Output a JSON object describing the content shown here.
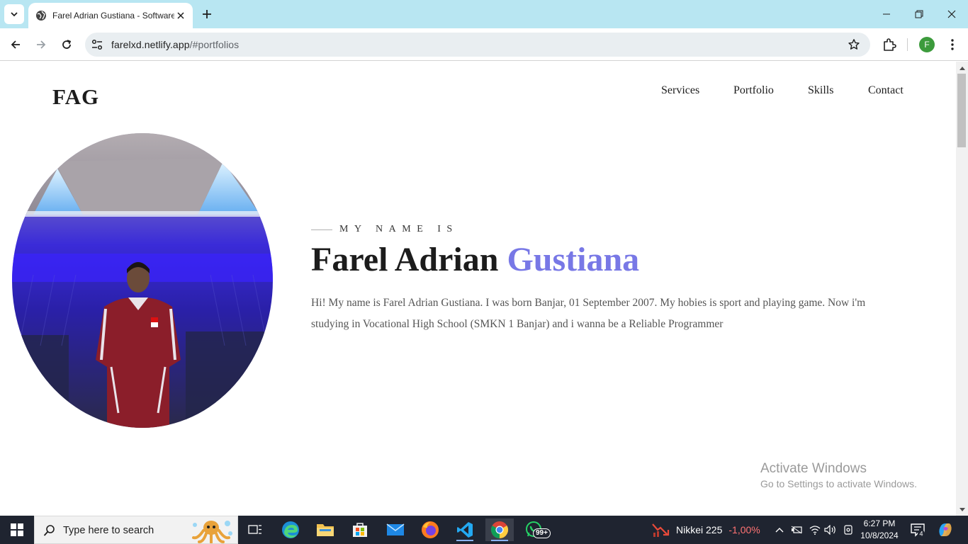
{
  "browser": {
    "tab_title": "Farel Adrian Gustiana - Software Engineer",
    "url_host": "farelxd.netlify.app",
    "url_path": "/#portfolios",
    "profile_initial": "F"
  },
  "site": {
    "brand": "FAG",
    "nav": [
      "Services",
      "Portfolio",
      "Skills",
      "Contact"
    ],
    "eyebrow": "MY NAME IS",
    "first_name": "Farel Adrian",
    "last_name": "Gustiana",
    "bio": "Hi! My name is Farel Adrian Gustiana. I was born Banjar, 01 September 2007. My hobies is sport and playing game. Now i'm studying in Vocational High School (SMKN 1 Banjar) and i wanna be a Reliable Programmer",
    "accent_color": "#7878e6"
  },
  "watermark": {
    "title": "Activate Windows",
    "subtitle": "Go to Settings to activate Windows."
  },
  "taskbar": {
    "search_placeholder": "Type here to search",
    "whatsapp_badge": "99+",
    "ticker_name": "Nikkei 225",
    "ticker_change": "-1,00%",
    "time": "6:27 PM",
    "date": "10/8/2024",
    "notification_count": "4",
    "apps": [
      "task-view",
      "edge",
      "file-explorer",
      "microsoft-store",
      "mail",
      "firefox",
      "vscode",
      "chrome",
      "whatsapp"
    ]
  }
}
